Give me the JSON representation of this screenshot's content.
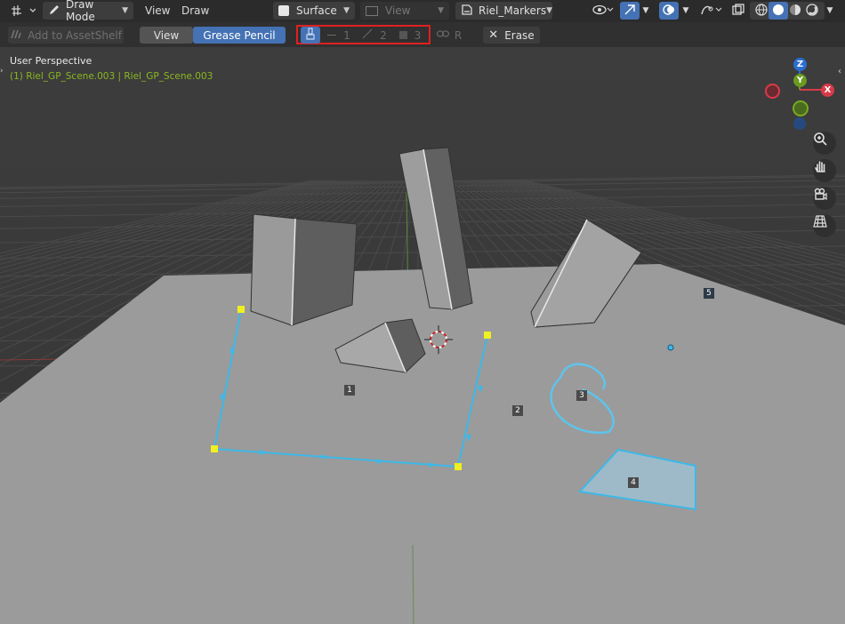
{
  "header": {
    "mode": "Draw Mode",
    "menus": [
      "View",
      "Draw"
    ],
    "placement": "Surface",
    "view_dropdown": "View",
    "layer": "Riel_Markers"
  },
  "toolbar": {
    "asset_shelf": "Add to AssetShelf",
    "view_tab": "View",
    "gp_tab": "Grease Pencil",
    "sel_1": "1",
    "sel_2": "2",
    "sel_3": "3",
    "r_label": "R",
    "erase": "Erase"
  },
  "viewport": {
    "perspective": "User Perspective",
    "object_info": "(1) Riel_GP_Scene.003 | Riel_GP_Scene.003",
    "markers": [
      "1",
      "2",
      "3",
      "4",
      "5"
    ]
  },
  "gizmo": {
    "z": "Z",
    "y": "Y",
    "x": "X"
  },
  "colors": {
    "stroke": "#3db8e8",
    "accent_blue": "#4472b4",
    "highlight_red": "#e02020",
    "point_yellow": "#f0f020",
    "x_axis": "#d83a4a",
    "y_axis": "#6a9a20",
    "z_axis": "#2a6ed0"
  }
}
